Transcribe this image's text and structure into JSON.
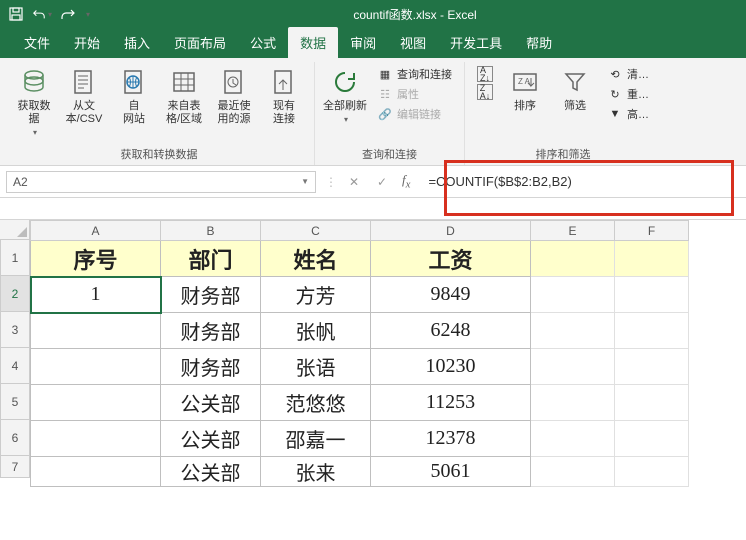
{
  "titlebar": {
    "title": "countif函数.xlsx - Excel"
  },
  "tabs": {
    "file": "文件",
    "home": "开始",
    "insert": "插入",
    "pagelayout": "页面布局",
    "formulas": "公式",
    "data": "数据",
    "review": "审阅",
    "view": "视图",
    "developer": "开发工具",
    "help": "帮助"
  },
  "ribbon": {
    "getdata": {
      "get_external": "获取数\n据",
      "from_text": "从文\n本/CSV",
      "from_web": "自\n网站",
      "from_table": "来自表\n格/区域",
      "recent": "最近使\n用的源",
      "existing": "现有\n连接",
      "group_label": "获取和转换数据"
    },
    "queries": {
      "refresh": "全部刷新",
      "conn": "查询和连接",
      "props": "属性",
      "links": "编辑链接",
      "group_label": "查询和连接"
    },
    "sort": {
      "sort": "排序",
      "filter": "筛选",
      "clear": "清…",
      "reapply": "重…",
      "adv": "高…",
      "group_label": "排序和筛选"
    }
  },
  "formula_bar": {
    "name": "A2",
    "formula": "=COUNTIF($B$2:B2,B2)"
  },
  "columns": [
    "A",
    "B",
    "C",
    "D",
    "E",
    "F"
  ],
  "row_numbers": [
    "1",
    "2",
    "3",
    "4",
    "5",
    "6",
    "7"
  ],
  "headers": {
    "a": "序号",
    "b": "部门",
    "c": "姓名",
    "d": "工资"
  },
  "rows": [
    {
      "a": "1",
      "b": "财务部",
      "c": "方芳",
      "d": "9849"
    },
    {
      "a": "",
      "b": "财务部",
      "c": "张帆",
      "d": "6248"
    },
    {
      "a": "",
      "b": "财务部",
      "c": "张语",
      "d": "10230"
    },
    {
      "a": "",
      "b": "公关部",
      "c": "范悠悠",
      "d": "11253"
    },
    {
      "a": "",
      "b": "公关部",
      "c": "邵嘉一",
      "d": "12378"
    },
    {
      "a": "",
      "b": "公关部",
      "c": "张来",
      "d": "5061"
    }
  ]
}
